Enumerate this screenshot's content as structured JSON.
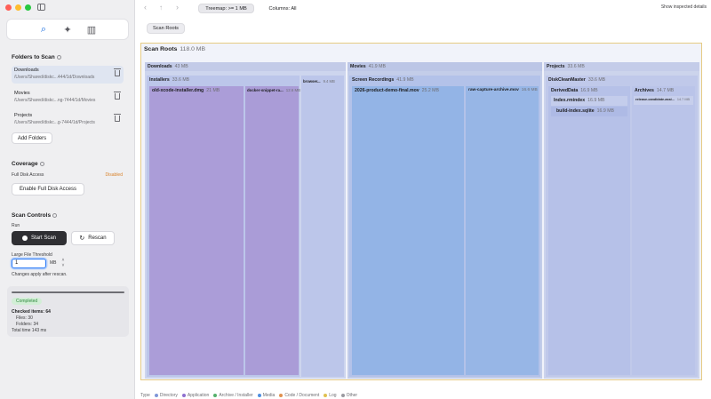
{
  "sidebar": {
    "toggle_icon": "sidebar-toggle-icon",
    "tabs": [
      {
        "icon": "magnifier-icon",
        "glyph": "⌕"
      },
      {
        "icon": "sparkle-icon",
        "glyph": "✦"
      },
      {
        "icon": "bar-chart-icon",
        "glyph": "▥"
      }
    ],
    "folders_title": "Folders to Scan",
    "folders": [
      {
        "name": "Downloads",
        "path": "/Users/Shared/diskc...444/1d/Downloads"
      },
      {
        "name": "Movies",
        "path": "/Users/Shared/diskc...ng-7444/1d/Movies"
      },
      {
        "name": "Projects",
        "path": "/Users/Shared/diskc...g-7444/1d/Projects"
      }
    ],
    "add_folders_label": "Add Folders",
    "coverage_title": "Coverage",
    "full_disk_label": "Full Disk Access",
    "full_disk_status": "Disabled",
    "enable_fda_label": "Enable Full Disk Access",
    "scan_controls_title": "Scan Controls",
    "run_label": "Run",
    "start_scan_label": "Start Scan",
    "rescan_label": "Rescan",
    "threshold_label": "Large File Threshold",
    "threshold_value": "1",
    "threshold_unit": "MB",
    "changes_note": "Changes apply after rescan.",
    "status": {
      "progress": 1.0,
      "badge": "Completed",
      "checked_items": "Checked items: 64",
      "files": "Files: 30",
      "folders": "Folders: 34",
      "total_time": "Total time 143 ms"
    }
  },
  "toolbar": {
    "back_glyph": "‹",
    "up_glyph": "↑",
    "forward_glyph": "›",
    "treemap_filter": "Treemap: >= 1 MB",
    "columns_filter": "Columns: All",
    "show_details": "Show inspected details"
  },
  "scan_roots_button": "Scan Roots",
  "treemap": {
    "root": {
      "name": "Scan Roots",
      "size": "118.0 MB"
    },
    "groups": [
      {
        "name": "Downloads",
        "size": "43 MB"
      },
      {
        "name": "Movies",
        "size": "41.9 MB"
      },
      {
        "name": "Projects",
        "size": "33.6 MB"
      }
    ],
    "subgroups": [
      {
        "name": "Installers",
        "size": "33.6 MB"
      },
      {
        "name": "Screen Recordings",
        "size": "41.9 MB"
      },
      {
        "name": "DiskCleanMaster",
        "size": "33.6 MB"
      },
      {
        "name": "DerivedData",
        "size": "16.9 MB"
      },
      {
        "name": "Archives",
        "size": "14.7 MB"
      }
    ],
    "files": [
      {
        "name": "old-xcode-installer.dmg",
        "size": "21 MB"
      },
      {
        "name": "docker-snippet-ra...",
        "size": "12.6 MB"
      },
      {
        "name": "browser...",
        "size": "9.4 MB"
      },
      {
        "name": "2026-product-demo-final.mov",
        "size": "25.2 MB"
      },
      {
        "name": "raw-capture-archive.mov",
        "size": "16.6 MB"
      },
      {
        "name": "Index.rmindex",
        "size": "16.9 MB"
      },
      {
        "name": "build-index.sqlite",
        "size": "16.9 MB"
      },
      {
        "name": "release-candidate-assi...",
        "size": "14.7 MB"
      }
    ],
    "colors": {
      "application": "#a99bd6",
      "directory": "#bfc8ea",
      "media": "#93b4e6",
      "header": "#c9d1ec"
    }
  },
  "legend": {
    "title": "Type",
    "items": [
      {
        "label": "Directory",
        "color": "#7f96d8"
      },
      {
        "label": "Application",
        "color": "#8e6fcf"
      },
      {
        "label": "Archive / Installer",
        "color": "#54b06b"
      },
      {
        "label": "Media",
        "color": "#4f8fe0"
      },
      {
        "label": "Code / Document",
        "color": "#e0914f"
      },
      {
        "label": "Log",
        "color": "#e0c04f"
      },
      {
        "label": "Other",
        "color": "#9a9aa0"
      }
    ]
  }
}
